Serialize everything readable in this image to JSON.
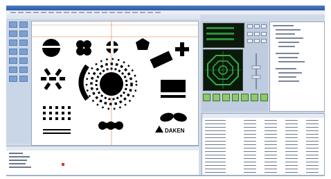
{
  "window": {
    "title": ""
  },
  "canvas": {
    "logo_text": "DAKEN",
    "crosshair_color": "#e07a3a",
    "shapes": [
      {
        "name": "circle-slot-icon"
      },
      {
        "name": "clover-icon"
      },
      {
        "name": "cross-circle-icon"
      },
      {
        "name": "pentagon-icon"
      },
      {
        "name": "plus-icon"
      },
      {
        "name": "rotated-rectangle-icon"
      },
      {
        "name": "asterisk-icon"
      },
      {
        "name": "arc-icon"
      },
      {
        "name": "ring-of-dots-icon"
      },
      {
        "name": "rectangle-icon"
      },
      {
        "name": "dot-grid-icon"
      },
      {
        "name": "leaf-icon"
      },
      {
        "name": "chain-icon"
      }
    ]
  },
  "panels": {
    "lcd_color": "#2e8f3a",
    "scope_color": "#34b04a"
  }
}
